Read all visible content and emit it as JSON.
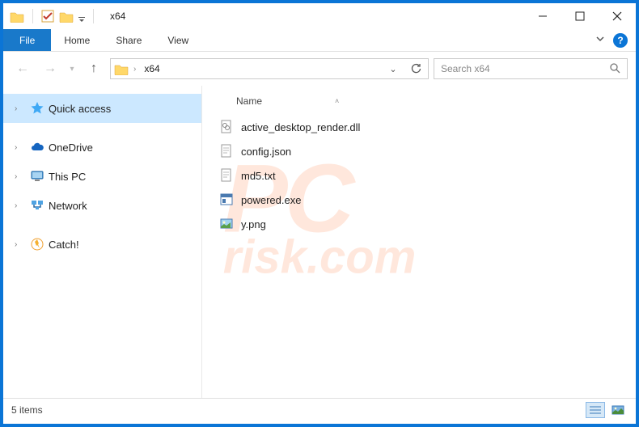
{
  "window": {
    "title": "x64"
  },
  "ribbon": {
    "file": "File",
    "tabs": [
      "Home",
      "Share",
      "View"
    ]
  },
  "address": {
    "crumb": "x64",
    "search_placeholder": "Search x64"
  },
  "sidebar": {
    "items": [
      {
        "label": "Quick access",
        "icon": "star",
        "selected": true
      },
      {
        "label": "OneDrive",
        "icon": "cloud",
        "selected": false
      },
      {
        "label": "This PC",
        "icon": "pc",
        "selected": false
      },
      {
        "label": "Network",
        "icon": "network",
        "selected": false
      },
      {
        "label": "Catch!",
        "icon": "catch",
        "selected": false
      }
    ]
  },
  "columns": {
    "name": "Name"
  },
  "files": [
    {
      "name": "active_desktop_render.dll",
      "type": "dll"
    },
    {
      "name": "config.json",
      "type": "text"
    },
    {
      "name": "md5.txt",
      "type": "text"
    },
    {
      "name": "powered.exe",
      "type": "exe"
    },
    {
      "name": "y.png",
      "type": "image"
    }
  ],
  "status": {
    "count_label": "5 items"
  },
  "watermark": {
    "main": "PC",
    "sub": "risk.com"
  }
}
